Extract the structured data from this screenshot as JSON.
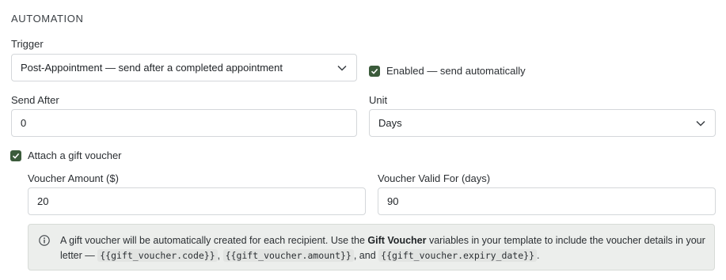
{
  "section": {
    "title": "AUTOMATION"
  },
  "trigger": {
    "label": "Trigger",
    "value": "Post-Appointment — send after a completed appointment"
  },
  "enabled": {
    "label": "Enabled — send automatically",
    "checked": true
  },
  "send_after": {
    "label": "Send After",
    "value": "0"
  },
  "unit": {
    "label": "Unit",
    "value": "Days"
  },
  "gift_voucher": {
    "label": "Attach a gift voucher",
    "checked": true,
    "amount": {
      "label": "Voucher Amount ($)",
      "value": "20"
    },
    "valid_for": {
      "label": "Voucher Valid For (days)",
      "value": "90"
    }
  },
  "info": {
    "text_1": "A gift voucher will be automatically created for each recipient. Use the ",
    "bold": "Gift Voucher",
    "text_2": " variables in your template to include the voucher details in your letter — ",
    "var_code": "{{gift_voucher.code}}",
    "sep_1": ", ",
    "var_amount": "{{gift_voucher.amount}}",
    "sep_2": ", and ",
    "var_expiry": "{{gift_voucher.expiry_date}}",
    "end": "."
  },
  "icons": {
    "chevron": "chevron-down-icon",
    "check": "check-icon",
    "info": "info-icon"
  },
  "colors": {
    "checkbox": "#3b5b3b",
    "info_bg": "#eceeec"
  }
}
